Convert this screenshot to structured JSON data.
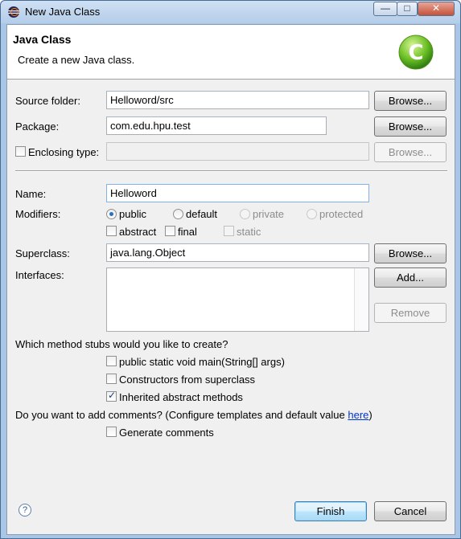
{
  "window": {
    "title": "New Java Class",
    "controls": {
      "minimize": "—",
      "maximize": "□",
      "close": "✕"
    }
  },
  "banner": {
    "title": "Java Class",
    "description": "Create a new Java class.",
    "logo_icon": "java-class-logo-icon",
    "logo_letter": "C"
  },
  "form": {
    "source_folder": {
      "label": "Source folder:",
      "value": "Helloword/src",
      "button": "Browse..."
    },
    "package": {
      "label": "Package:",
      "value": "com.edu.hpu.test",
      "button": "Browse..."
    },
    "enclosing_type": {
      "label": "Enclosing type:",
      "value": "",
      "button": "Browse...",
      "checked": false
    },
    "name": {
      "label": "Name:",
      "value": "Helloword"
    },
    "modifiers": {
      "label": "Modifiers:",
      "access": [
        {
          "label": "public",
          "selected": true,
          "enabled": true
        },
        {
          "label": "default",
          "selected": false,
          "enabled": true
        },
        {
          "label": "private",
          "selected": false,
          "enabled": false
        },
        {
          "label": "protected",
          "selected": false,
          "enabled": false
        }
      ],
      "flags": [
        {
          "label": "abstract",
          "checked": false,
          "enabled": true
        },
        {
          "label": "final",
          "checked": false,
          "enabled": true
        },
        {
          "label": "static",
          "checked": false,
          "enabled": false
        }
      ]
    },
    "superclass": {
      "label": "Superclass:",
      "value": "java.lang.Object",
      "button": "Browse..."
    },
    "interfaces": {
      "label": "Interfaces:",
      "add_button": "Add...",
      "remove_button": "Remove"
    },
    "stubs": {
      "question": "Which method stubs would you like to create?",
      "options": [
        {
          "label": "public static void main(String[] args)",
          "checked": false
        },
        {
          "label": "Constructors from superclass",
          "checked": false
        },
        {
          "label": "Inherited abstract methods",
          "checked": true
        }
      ]
    },
    "comments": {
      "question_prefix": "Do you want to add comments? (Configure templates and default value ",
      "link": "here",
      "question_suffix": ")",
      "option": {
        "label": "Generate comments",
        "checked": false
      }
    }
  },
  "footer": {
    "help_icon": "?",
    "finish": "Finish",
    "cancel": "Cancel"
  },
  "check_glyph": "✓"
}
